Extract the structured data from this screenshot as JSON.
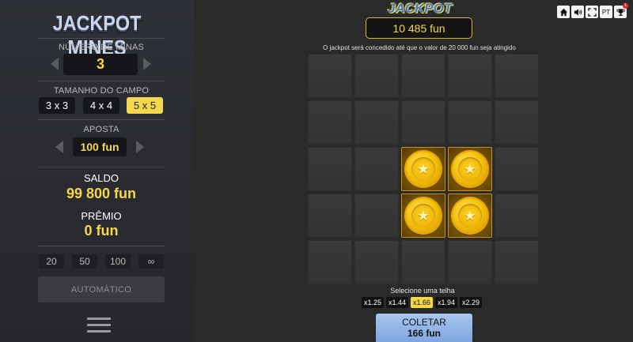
{
  "left": {
    "logo": "JACKPOT MINES",
    "mines": {
      "label": "NÚMERO DE MINAS",
      "value": "3"
    },
    "field": {
      "label": "TAMANHO DO CAMPO",
      "options": [
        "3 x 3",
        "4 x 4",
        "5 x 5"
      ],
      "selected": "5 x 5"
    },
    "bet": {
      "label": "APOSTA",
      "value": "100 fun"
    },
    "balance": {
      "label": "SALDO",
      "value": "99 800 fun"
    },
    "prize": {
      "label": "PRÊMIO",
      "value": "0 fun"
    },
    "auto_counts": [
      "20",
      "50",
      "100",
      "∞"
    ],
    "auto_button": "AUTOMÁTICO"
  },
  "jackpot": {
    "logo": "JACKPOT",
    "amount": "10 485 fun",
    "note": "O jackpot será concedido até que o valor de 20 000 fun seja atingido"
  },
  "board": {
    "size": 5,
    "revealed": [
      [
        2,
        2
      ],
      [
        2,
        3
      ],
      [
        3,
        2
      ],
      [
        3,
        3
      ]
    ],
    "select_label": "Selecione uma telha"
  },
  "multipliers": {
    "options": [
      "x1.25",
      "x1.44",
      "x1.66",
      "x1.94",
      "x2.29"
    ],
    "selected": "x1.66"
  },
  "collect": {
    "label": "COLETAR",
    "amount": "166 fun"
  },
  "top_icons": {
    "language": "PT",
    "trophy_badge": "1"
  },
  "colors": {
    "accent": "#f5d74c",
    "panel": "#2e3037",
    "board_bg": "#2a2a2a",
    "collect": "#a8c6ef"
  }
}
